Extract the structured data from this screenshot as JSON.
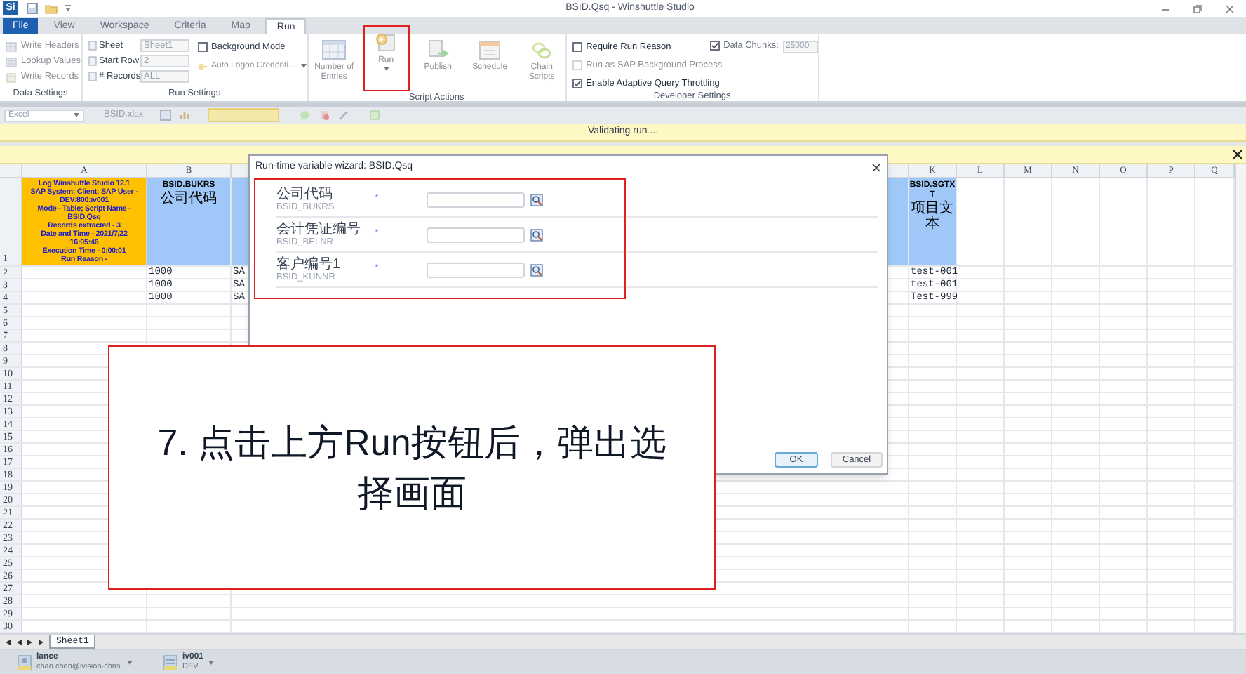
{
  "window": {
    "logo_text": "Si",
    "title": "BSID.Qsq - Winshuttle Studio"
  },
  "ribbon_tabs": [
    {
      "label": "File",
      "kind": "file",
      "selected": false
    },
    {
      "label": "View",
      "kind": "tab",
      "selected": false
    },
    {
      "label": "Workspace",
      "kind": "tab",
      "selected": false
    },
    {
      "label": "Criteria",
      "kind": "tab",
      "selected": false
    },
    {
      "label": "Map",
      "kind": "tab",
      "selected": false
    },
    {
      "label": "Run",
      "kind": "tab",
      "selected": true
    }
  ],
  "data_settings": {
    "title": "Data Settings",
    "commands": [
      {
        "label": "Write Headers",
        "kind": "table",
        "disabled": true
      },
      {
        "label": "Lookup Values",
        "kind": "lookup",
        "disabled": true
      },
      {
        "label": "Write Records",
        "kind": "records",
        "disabled": true
      }
    ]
  },
  "run_settings": {
    "title": "Run Settings",
    "fields": [
      {
        "label": "Sheet",
        "value": "Sheet1"
      },
      {
        "label": "Start Row",
        "value": "2"
      },
      {
        "label": "# Records",
        "value": "ALL"
      }
    ],
    "background_mode": {
      "label": "Background Mode",
      "checked": false
    },
    "auto_logon": {
      "label": "Auto Logon Credenti...",
      "disabled": true
    }
  },
  "script_actions": {
    "title": "Script Actions",
    "buttons": [
      {
        "label": "Number of Entries",
        "kind": "entries",
        "disabled": true,
        "annotated": false
      },
      {
        "label": "Run",
        "kind": "run",
        "disabled": true,
        "annotated": true
      },
      {
        "label": "Publish",
        "kind": "publish",
        "disabled": true,
        "annotated": false
      },
      {
        "label": "Schedule",
        "kind": "schedule",
        "disabled": true,
        "annotated": false
      },
      {
        "label": "Chain Scripts",
        "kind": "chain",
        "disabled": true,
        "annotated": false
      }
    ]
  },
  "developer_settings": {
    "title": "Developer Settings",
    "options": [
      {
        "label": "Require Run Reason",
        "checked": false,
        "disabled": false
      },
      {
        "label": "Run as SAP Background Process",
        "checked": false,
        "disabled": true
      },
      {
        "label": "Enable Adaptive Query Throttling",
        "checked": true,
        "disabled": false
      }
    ],
    "data_chunks": {
      "label": "Data Chunks:",
      "checked": true,
      "value": "25000"
    }
  },
  "toolbar": {
    "source": "Excel",
    "file": "BSID.xlsx"
  },
  "status_message": "Validating run ...",
  "sheet": {
    "columns": [
      "A",
      "B",
      "K",
      "L",
      "M",
      "N",
      "O",
      "P",
      "Q"
    ],
    "row_numbers": [
      "1",
      "2",
      "3",
      "4",
      "5",
      "6",
      "7",
      "8",
      "9",
      "10",
      "11",
      "12",
      "13",
      "14",
      "15",
      "16",
      "17",
      "18",
      "19",
      "20",
      "21",
      "22",
      "23",
      "24",
      "25",
      "26",
      "27",
      "28",
      "29",
      "30"
    ],
    "log_lines": [
      "Log Winshuttle Studio 12.1",
      "SAP System; Client; SAP User -",
      "DEV:800:iv001",
      "Mode  -  Table; Script Name  -",
      "BSID.Qsq",
      "Records extracted  -  3",
      "Date and Time  -  2021/7/22",
      "16:05:46",
      "Execution Time  -  0:00:01",
      "Run Reason  -"
    ],
    "header_fields": [
      {
        "name": "BSID.BUKRS",
        "text": "公司代码"
      },
      {
        "name": "BSID.SGTXT",
        "text": "项目文本"
      }
    ],
    "rows": [
      {
        "cells": [
          "1000",
          "SA",
          "test-001"
        ]
      },
      {
        "cells": [
          "1000",
          "SA",
          "test-001"
        ]
      },
      {
        "cells": [
          "1000",
          "SA",
          "Test-999"
        ]
      }
    ],
    "tabs": [
      {
        "label": "Sheet1",
        "selected": true
      }
    ]
  },
  "dialog": {
    "title": "Run-time variable wizard: BSID.Qsq",
    "annotated": true,
    "variables": [
      {
        "label": "公司代码",
        "name": "BSID_BUKRS",
        "mark": "*"
      },
      {
        "label": "会计凭证编号",
        "name": "BSID_BELNR",
        "mark": "*"
      },
      {
        "label": "客户编号1",
        "name": "BSID_KUNNR",
        "mark": "*"
      }
    ],
    "buttons": [
      {
        "label": "OK",
        "default": true
      },
      {
        "label": "Cancel",
        "default": false
      }
    ]
  },
  "annotation": {
    "caption": "7. 点击上方Run按钮后，弹出选择画面"
  },
  "status_bar": [
    {
      "name": "lance",
      "detail": "chao.chen@ivision-chns.",
      "kind": "user"
    },
    {
      "name": "iv001",
      "detail": "DEV",
      "kind": "system"
    }
  ]
}
